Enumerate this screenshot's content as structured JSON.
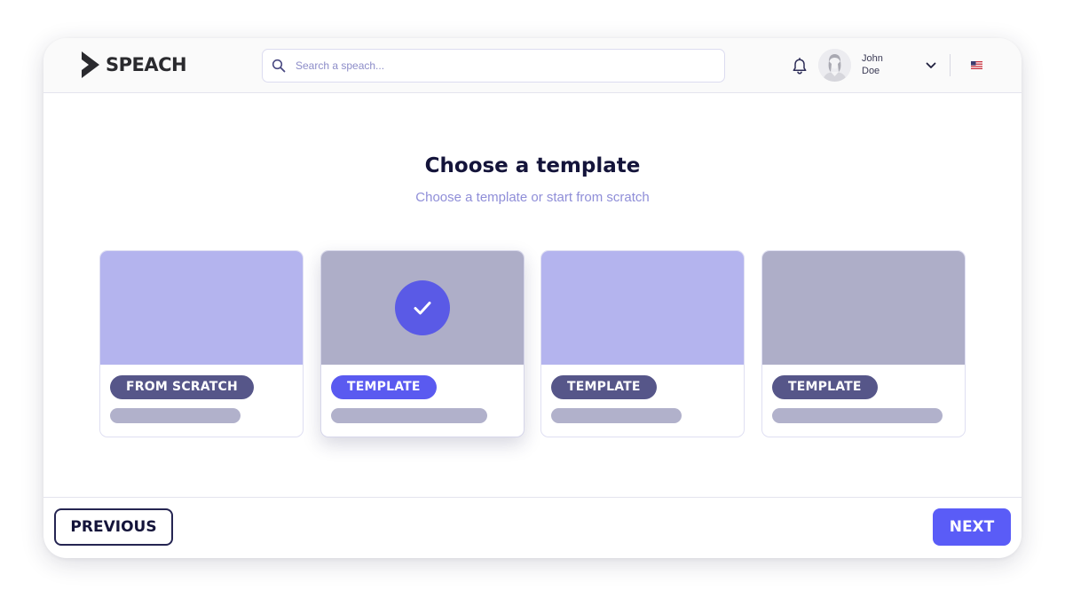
{
  "app": {
    "logo_text": "SPEACH",
    "brand_color": "#5a5cf7"
  },
  "header": {
    "search": {
      "placeholder": "Search a speach..."
    },
    "icons": {
      "search": "search-icon",
      "notifications": "bell-icon",
      "menu": "chevron-down-icon",
      "language": "us-flag-icon"
    },
    "user": {
      "first_name": "John",
      "last_name": "Doe"
    }
  },
  "main": {
    "title": "Choose a template",
    "subtitle": "Choose a template or start from scratch",
    "cards": [
      {
        "label": "FROM SCRATCH",
        "selected": false,
        "thumb_color": "#b4b4ee"
      },
      {
        "label": "TEMPLATE",
        "selected": true,
        "thumb_color": "#aeaec8"
      },
      {
        "label": "TEMPLATE",
        "selected": false,
        "thumb_color": "#b4b4ee"
      },
      {
        "label": "TEMPLATE",
        "selected": false,
        "thumb_color": "#aeaec8"
      }
    ]
  },
  "footer": {
    "previous_label": "PREVIOUS",
    "next_label": "NEXT"
  }
}
